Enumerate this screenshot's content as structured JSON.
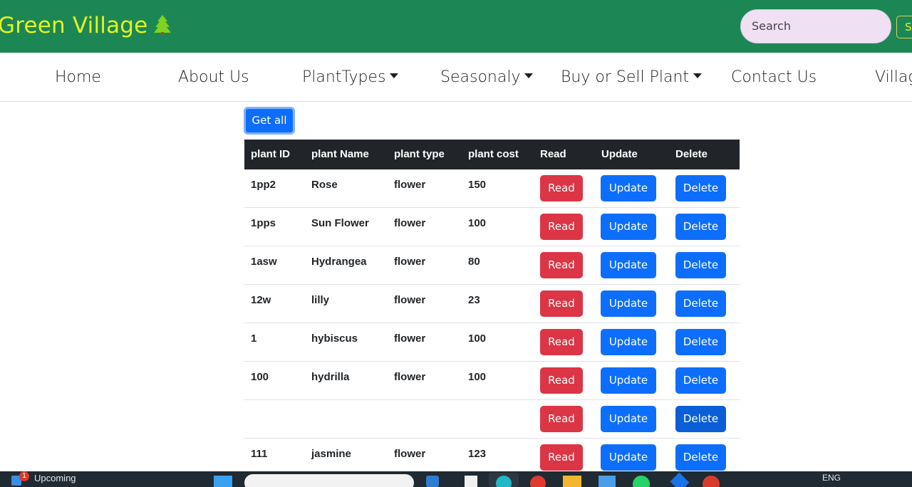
{
  "header": {
    "brand": "Green Village",
    "brand_icon": "evergreen-tree-icon",
    "search_placeholder": "Search",
    "search_button": "S"
  },
  "nav": {
    "items": [
      {
        "label": "Home",
        "dropdown": false
      },
      {
        "label": "About Us",
        "dropdown": false
      },
      {
        "label": "PlantTypes",
        "dropdown": true
      },
      {
        "label": "Seasonaly",
        "dropdown": true
      },
      {
        "label": "Buy or Sell Plant",
        "dropdown": true
      },
      {
        "label": "Contact Us",
        "dropdown": false
      },
      {
        "label": "Villag",
        "dropdown": false
      }
    ]
  },
  "get_all_label": "Get all",
  "table": {
    "headers": [
      "plant ID",
      "plant Name",
      "plant type",
      "plant cost",
      "Read",
      "Update",
      "Delete"
    ],
    "rows": [
      {
        "id": "1pp2",
        "name": "Rose",
        "type": "flower",
        "cost": "150"
      },
      {
        "id": "1pps",
        "name": "Sun Flower",
        "type": "flower",
        "cost": "100"
      },
      {
        "id": "1asw",
        "name": "Hydrangea",
        "type": "flower",
        "cost": "80"
      },
      {
        "id": "12w",
        "name": "lilly",
        "type": "flower",
        "cost": "23"
      },
      {
        "id": "1",
        "name": "hybiscus",
        "type": "flower",
        "cost": "100"
      },
      {
        "id": "100",
        "name": "hydrilla",
        "type": "flower",
        "cost": "100"
      },
      {
        "id": "",
        "name": "",
        "type": "",
        "cost": ""
      },
      {
        "id": "111",
        "name": "jasmine",
        "type": "flower",
        "cost": "123"
      }
    ],
    "read_label": "Read",
    "update_label": "Update",
    "delete_label": "Delete"
  },
  "taskbar": {
    "notification_count": "1",
    "upcoming_label": "Upcoming",
    "lang": "ENG"
  },
  "colors": {
    "header_bg": "#1c8754",
    "brand_text": "#e4f320",
    "primary": "#0d6efd",
    "danger": "#dc3545",
    "table_head": "#212529"
  }
}
